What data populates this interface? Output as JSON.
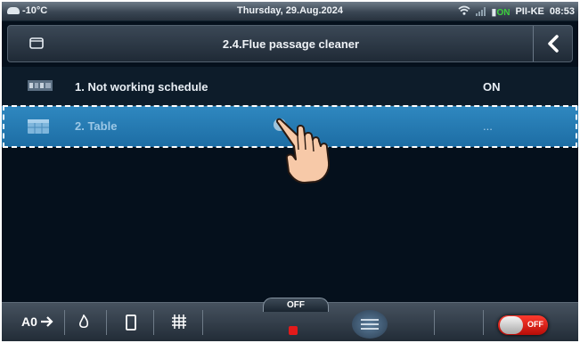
{
  "status_bar": {
    "temperature": "-10°C",
    "date": "Thursday, 29.Aug.2024",
    "on_badge": "ON",
    "device": "PII-KE",
    "time": "08:53"
  },
  "header": {
    "title": "2.4.Flue passage cleaner"
  },
  "list": [
    {
      "label": "1.  Not working schedule",
      "value": "ON",
      "icon": "schedule-icon"
    },
    {
      "label": "2.  Table",
      "value": "...",
      "icon": "table-icon",
      "selected": true
    }
  ],
  "bottom_bar": {
    "mode_label": "OFF",
    "toggle_label": "OFF",
    "icons": [
      "modes-icon",
      "fire-icon",
      "card-icon",
      "grid-icon",
      "stop-icon",
      "menu-icon",
      "power-toggle"
    ]
  },
  "colors": {
    "accent_selected": "#2b82bb",
    "background": "#05101c",
    "toggle": "#e0241b",
    "stop": "#e31a1a"
  }
}
